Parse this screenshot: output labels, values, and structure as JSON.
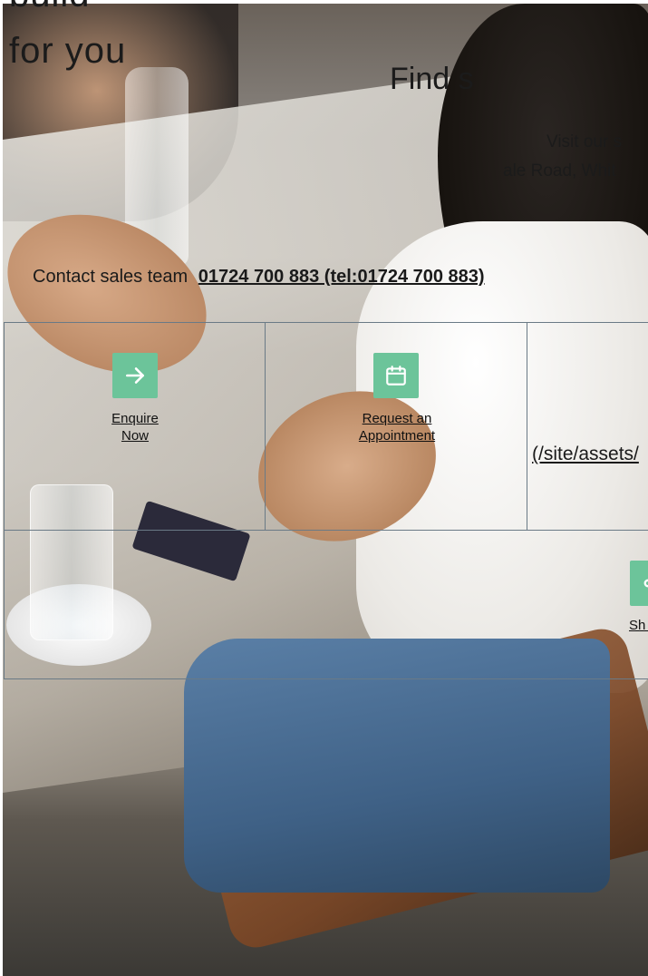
{
  "hero": {
    "line1": "build",
    "line2": "for you"
  },
  "location": {
    "heading": "Find s",
    "visit": "Visit our s",
    "address": "ale Road, Whit"
  },
  "contact": {
    "label": "Contact sales team",
    "phone_link": "01724 700 883 (tel:01724 700 883)"
  },
  "actions": {
    "enquire": {
      "label": "Enquire Now",
      "icon": "arrow-right-icon"
    },
    "appointment": {
      "label": "Request an Appointment",
      "icon": "calendar-icon"
    },
    "assets_link": "(/site/assets/",
    "share": {
      "label": "Sh T",
      "icon": "share-icon"
    }
  },
  "colors": {
    "accent": "#6cc49a",
    "grid_border": "#6a7a86",
    "text": "#1b1b1b"
  }
}
